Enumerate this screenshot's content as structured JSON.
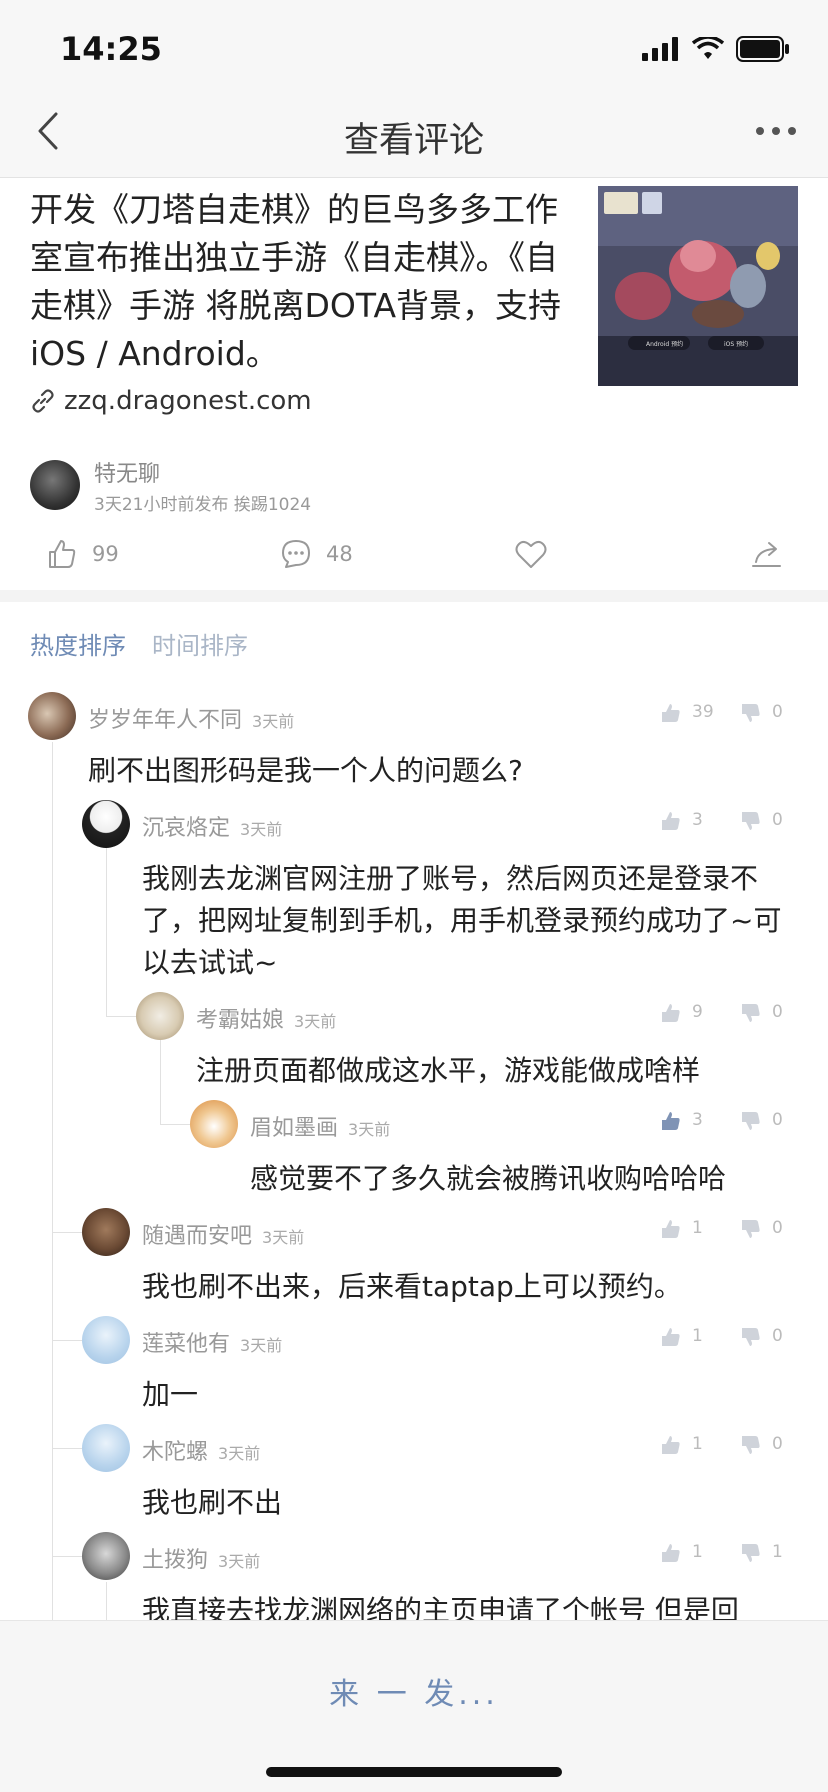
{
  "status": {
    "time": "14:25"
  },
  "nav": {
    "title": "查看评论"
  },
  "post": {
    "text": "开发《刀塔自走棋》的巨鸟多多工作室宣布推出独立手游《自走棋》。《自走棋》手游 将脱离DOTA背景，支持 iOS / Android。",
    "link": "zzq.dragonest.com",
    "thumb_android": "Android 预约",
    "thumb_ios": "iOS 预约",
    "author": "特无聊",
    "meta": "3天21小时前发布 挨踢1024",
    "likes": "99",
    "comments": "48"
  },
  "sort": {
    "hot": "热度排序",
    "time": "时间排序"
  },
  "comments": [
    {
      "name": "岁岁年年人不同",
      "time": "3天前",
      "likes": "39",
      "dislikes": "0",
      "text": "刷不出图形码是我一个人的问题么?"
    },
    {
      "name": "沉哀烙定",
      "time": "3天前",
      "likes": "3",
      "dislikes": "0",
      "text": "我刚去龙渊官网注册了账号，然后网页还是登录不了，把网址复制到手机，用手机登录预约成功了~可以去试试~"
    },
    {
      "name": "考霸姑娘",
      "time": "3天前",
      "likes": "9",
      "dislikes": "0",
      "text": "注册页面都做成这水平，游戏能做成啥样"
    },
    {
      "name": "眉如墨画",
      "time": "3天前",
      "likes": "3",
      "dislikes": "0",
      "text": "感觉要不了多久就会被腾讯收购哈哈哈"
    },
    {
      "name": "随遇而安吧",
      "time": "3天前",
      "likes": "1",
      "dislikes": "0",
      "text": "我也刷不出来，后来看taptap上可以预约。"
    },
    {
      "name": "莲菜他有",
      "time": "3天前",
      "likes": "1",
      "dislikes": "0",
      "text": "加一"
    },
    {
      "name": "木陀螺",
      "time": "3天前",
      "likes": "1",
      "dislikes": "0",
      "text": "我也刷不出"
    },
    {
      "name": "土拨狗",
      "time": "3天前",
      "likes": "1",
      "dislikes": "1",
      "text": "我直接去找龙渊网络的主页申请了个帐号 但是回"
    }
  ],
  "footer": {
    "reply_placeholder": "来 一 发..."
  },
  "colors": {
    "accent": "#6f8bb5",
    "text": "#222222",
    "muted": "#999999"
  }
}
